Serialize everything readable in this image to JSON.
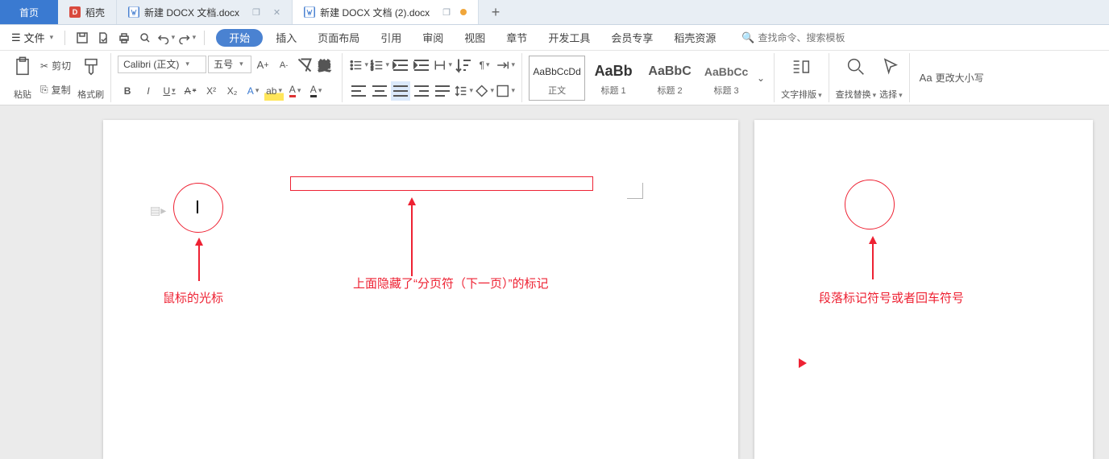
{
  "tabs": {
    "home": "首页",
    "shell": "稻壳",
    "doc1": "新建 DOCX 文档.docx",
    "doc2": "新建 DOCX 文档 (2).docx"
  },
  "menu": {
    "file": "文件",
    "items": [
      "开始",
      "插入",
      "页面布局",
      "引用",
      "审阅",
      "视图",
      "章节",
      "开发工具",
      "会员专享",
      "稻壳资源"
    ],
    "search_placeholder": "查找命令、搜索模板"
  },
  "ribbon": {
    "paste": "粘贴",
    "cut": "剪切",
    "copy": "复制",
    "format_painter": "格式刷",
    "font_name": "Calibri (正文)",
    "font_size": "五号",
    "styles": [
      {
        "preview": "AaBbCcDd",
        "label": "正文"
      },
      {
        "preview": "AaBb",
        "label": "标题 1"
      },
      {
        "preview": "AaBbC",
        "label": "标题 2"
      },
      {
        "preview": "AaBbCc",
        "label": "标题 3"
      }
    ],
    "text_layout": "文字排版",
    "find_replace": "查找替换",
    "select": "选择",
    "change_case": "更改大小写"
  },
  "annotations": {
    "cursor_label": "鼠标的光标",
    "hidden_pagebreak": "上面隐藏了“分页符（下一页）”的标记",
    "para_mark": "段落标记符号或者回车符号"
  }
}
